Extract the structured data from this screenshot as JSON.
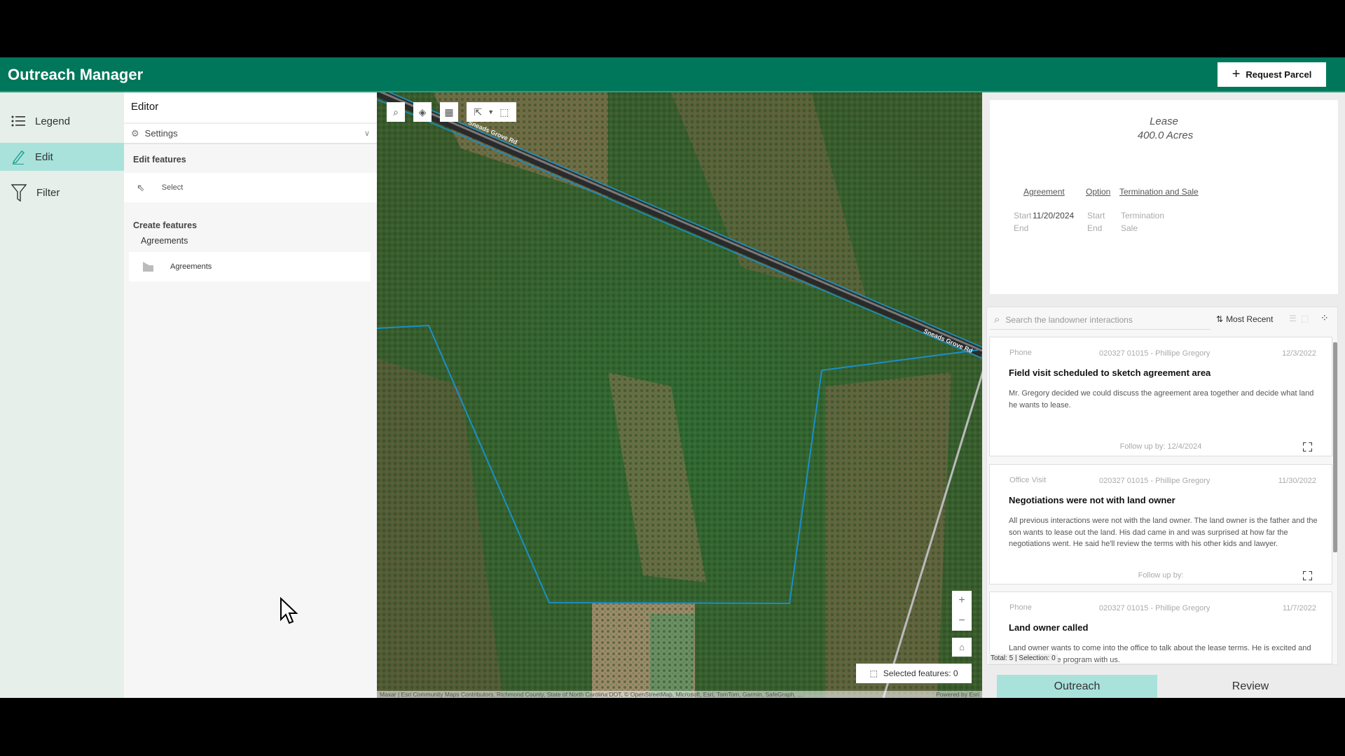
{
  "header": {
    "title": "Outreach Manager",
    "request_parcel": "Request Parcel"
  },
  "nav": {
    "items": [
      {
        "label": "Legend",
        "icon": "list-icon"
      },
      {
        "label": "Edit",
        "icon": "pencil-icon",
        "active": true
      },
      {
        "label": "Filter",
        "icon": "filter-icon"
      }
    ]
  },
  "editor": {
    "title": "Editor",
    "settings": "Settings",
    "edit_features": "Edit features",
    "select": "Select",
    "create_features": "Create features",
    "layer_group": "Agreements",
    "layer_item": "Agreements"
  },
  "map": {
    "road_label": "Sneads Grove Rd",
    "selected_features": "Selected features: 0",
    "attribution": "Maxar | Esri Community Maps Contributors, Richmond County, State of North Carolina DOT, © OpenStreetMap, Microsoft, Esri, TomTom, Garmin, SafeGraph, ...",
    "powered_by": "Powered by Esri",
    "parcel_color": "#1a8fc9"
  },
  "lease": {
    "type": "Lease",
    "acres": "400.0 Acres",
    "links": [
      "Agreement",
      "Option",
      "Termination and Sale"
    ],
    "agreement": {
      "start_label": "Start",
      "start_value": "11/20/2024",
      "end_label": "End"
    },
    "option": {
      "start_label": "Start",
      "end_label": "End"
    },
    "termination": {
      "termination_label": "Termination",
      "sale_label": "Sale"
    }
  },
  "interactions": {
    "search_placeholder": "Search the landowner interactions",
    "sort": "Most Recent",
    "total": "Total: 5 | Selection: 0",
    "cards": [
      {
        "type": "Phone",
        "id": "020327 01015  - Phillipe Gregory",
        "date": "12/3/2022",
        "title": "Field visit scheduled to sketch agreement area",
        "body": "Mr. Gregory decided we could discuss the agreement area together and decide what land he wants to lease.",
        "follow": "Follow up by: 12/4/2024"
      },
      {
        "type": "Office Visit",
        "id": "020327 01015  - Phillipe Gregory",
        "date": "11/30/2022",
        "title": "Negotiations were not with land owner",
        "body": "All previous interactions were not with the land owner. The land owner is the father and the son wants to lease out the land. His dad came in and was surprised at how far the negotiations went. He said he'll review the terms with his other kids and lawyer.",
        "follow": "Follow up by:"
      },
      {
        "type": "Phone",
        "id": "020327 01015  - Phillipe Gregory",
        "date": "11/7/2022",
        "title": "Land owner called",
        "body": "Land owner wants to come into the office to talk about the lease terms. He is excited and wants to do the program with us."
      }
    ]
  },
  "tabs": {
    "outreach": "Outreach",
    "review": "Review"
  }
}
